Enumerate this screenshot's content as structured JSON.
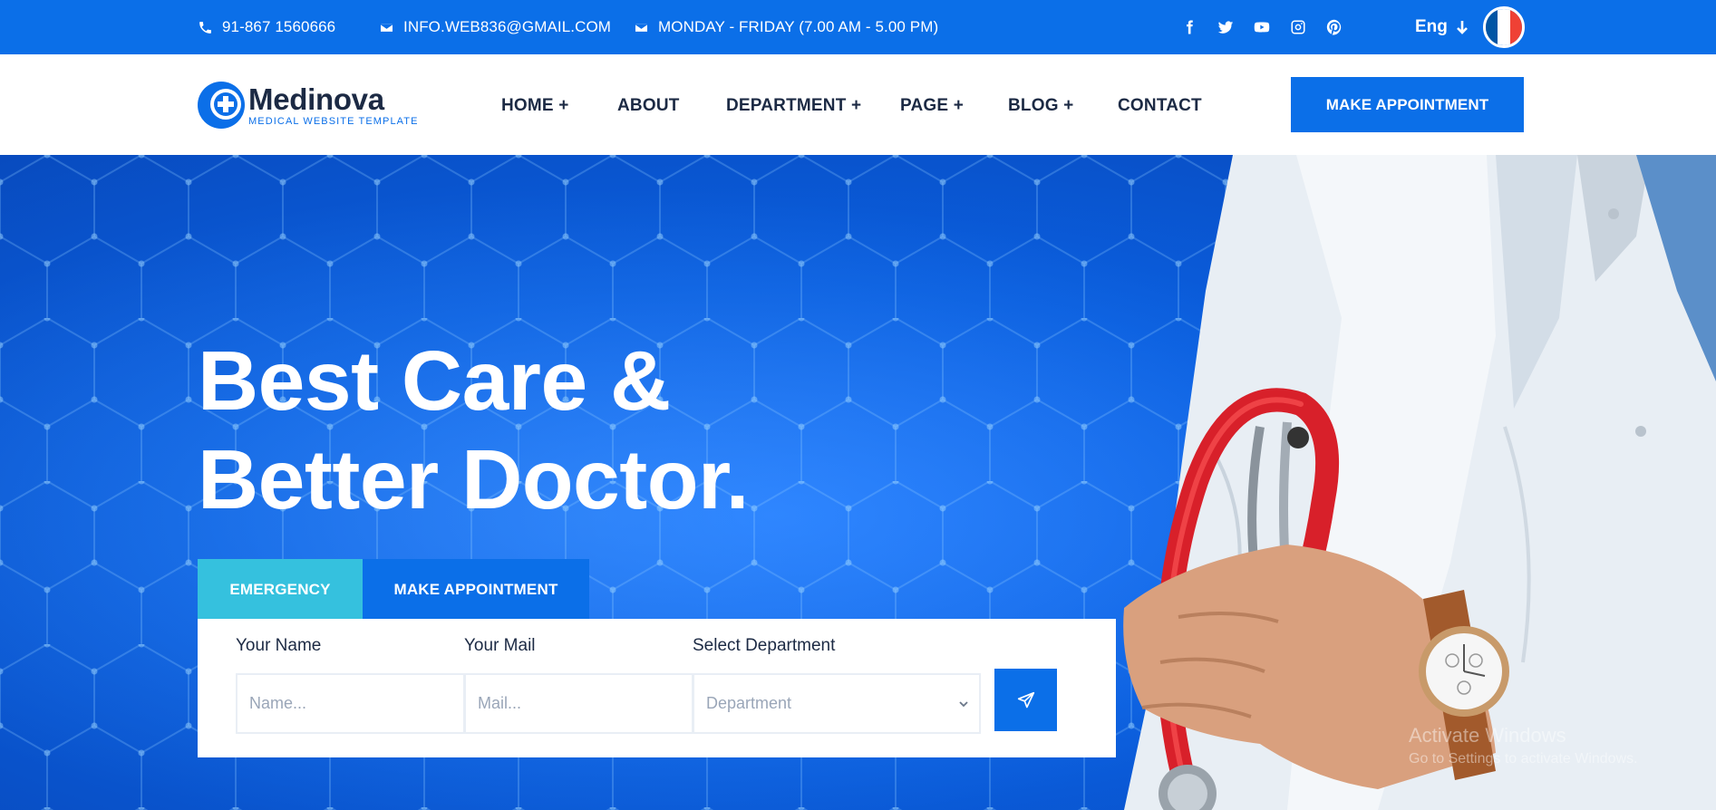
{
  "topbar": {
    "phone": "91-867 1560666",
    "email": "INFO.WEB836@GMAIL.COM",
    "hours": "MONDAY - FRIDAY (7.00 AM - 5.00 PM)",
    "socials": [
      "facebook-icon",
      "twitter-icon",
      "youtube-icon",
      "instagram-icon",
      "pinterest-icon"
    ],
    "language": "Eng",
    "flag_colors": [
      "#0055a4",
      "#ffffff",
      "#ef4135"
    ]
  },
  "navbar": {
    "logo_title": "Medinova",
    "logo_subtitle": "MEDICAL WEBSITE TEMPLATE",
    "items": [
      {
        "label": "HOME +"
      },
      {
        "label": "ABOUT"
      },
      {
        "label": "DEPARTMENT +"
      },
      {
        "label": "PAGE +"
      },
      {
        "label": "BLOG +"
      },
      {
        "label": "CONTACT"
      }
    ],
    "cta_label": "MAKE APPOINTMENT"
  },
  "hero": {
    "headline_line1": "Best Care &",
    "headline_line2": "Better Doctor.",
    "tabs": [
      {
        "label": "EMERGENCY",
        "active": true
      },
      {
        "label": "MAKE APPOINTMENT",
        "active": false
      }
    ],
    "form": {
      "name_label": "Your Name",
      "name_placeholder": "Name...",
      "mail_label": "Your Mail",
      "mail_placeholder": "Mail...",
      "department_label": "Select Department",
      "department_value": "Department"
    }
  },
  "watermark": {
    "line1": "Activate Windows",
    "line2": "Go to Settings to activate Windows."
  },
  "colors": {
    "primary": "#0b6fe8",
    "accent": "#35c1de",
    "dark_text": "#1c2a44"
  }
}
